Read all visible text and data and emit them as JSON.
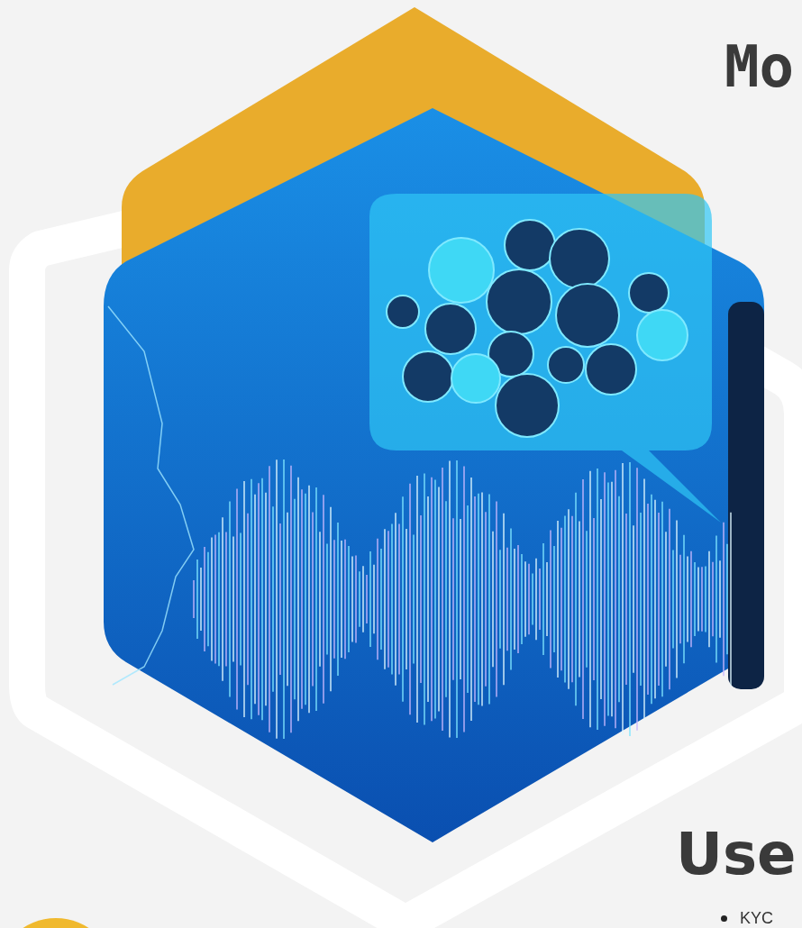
{
  "top_heading": "Mo",
  "section_heading": "Use",
  "list_items": [
    "KYC"
  ]
}
